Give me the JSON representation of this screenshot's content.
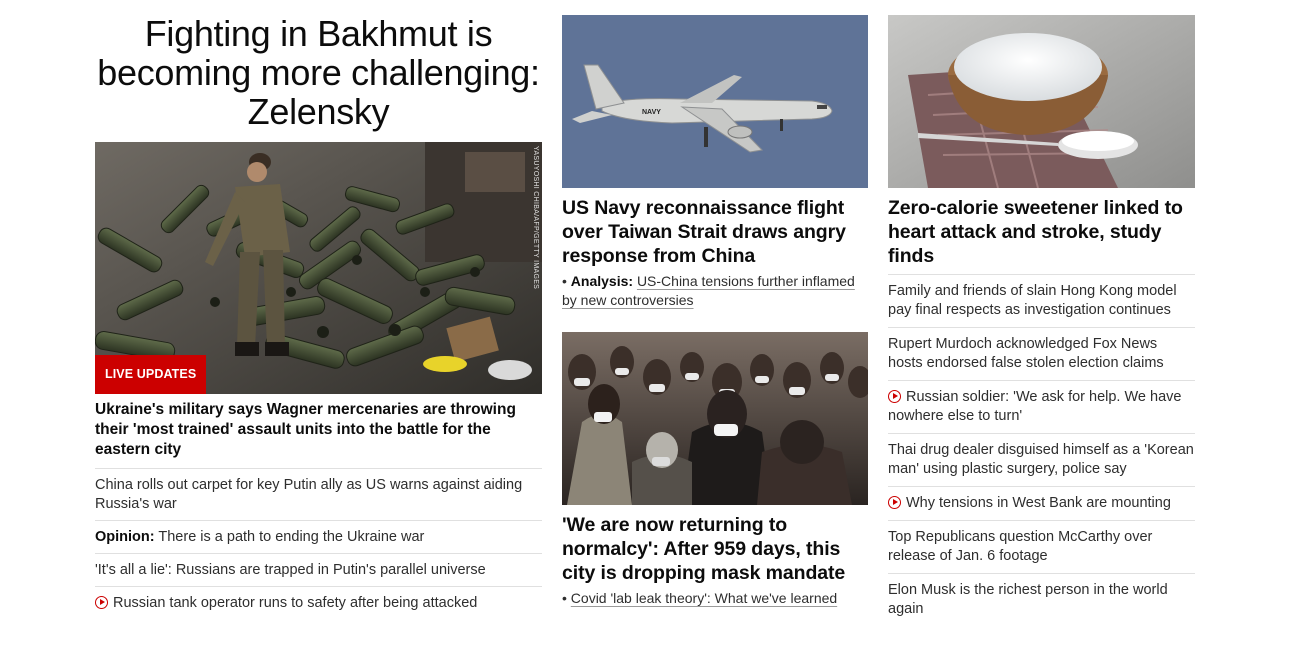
{
  "main": {
    "headline": "Fighting in Bakhmut is becoming more challenging: Zelensky",
    "badge": "LIVE UPDATES",
    "photo_credit": "YASUYOSHI CHIBA/AFP/GETTY IMAGES",
    "lead_story": "Ukraine's military says Wagner mercenaries are throwing their 'most trained' assault units into the battle for the eastern city",
    "stories": [
      {
        "text": "China rolls out carpet for key Putin ally as US warns against aiding Russia's war"
      },
      {
        "prefix": "Opinion:",
        "text": "There is a path to ending the Ukraine war"
      },
      {
        "text": "'It's all a lie': Russians are trapped in Putin's parallel universe"
      },
      {
        "video": true,
        "text": "Russian tank operator runs to safety after being attacked"
      }
    ]
  },
  "middle": {
    "card1": {
      "title": "US Navy reconnaissance flight over Taiwan Strait draws angry response from China",
      "sub_bullet": "•",
      "sub_label": "Analysis:",
      "sub_text": "US-China tensions further inflamed by new controversies",
      "plane_text": "NAVY"
    },
    "card2": {
      "title": "'We are now returning to normalcy': After 959 days, this city is dropping mask mandate",
      "sub_bullet": "•",
      "sub_text": "Covid 'lab leak theory': What we've learned"
    }
  },
  "right": {
    "card_title": "Zero-calorie sweetener linked to heart attack and stroke, study finds",
    "stories": [
      {
        "text": "Family and friends of slain Hong Kong model pay final respects as investigation continues"
      },
      {
        "text": "Rupert Murdoch acknowledged Fox News hosts endorsed false stolen election claims"
      },
      {
        "video": true,
        "text": "Russian soldier: 'We ask for help. We have nowhere else to turn'"
      },
      {
        "text": "Thai drug dealer disguised himself as a 'Korean man' using plastic surgery, police say"
      },
      {
        "video": true,
        "text": "Why tensions in West Bank are mounting"
      },
      {
        "text": "Top Republicans question McCarthy over release of Jan. 6 footage"
      },
      {
        "text": "Elon Musk is the richest person in the world again"
      }
    ]
  },
  "colors": {
    "accent_red": "#cc0000",
    "text": "#0c0c0c",
    "divider": "#e0e0e0"
  }
}
